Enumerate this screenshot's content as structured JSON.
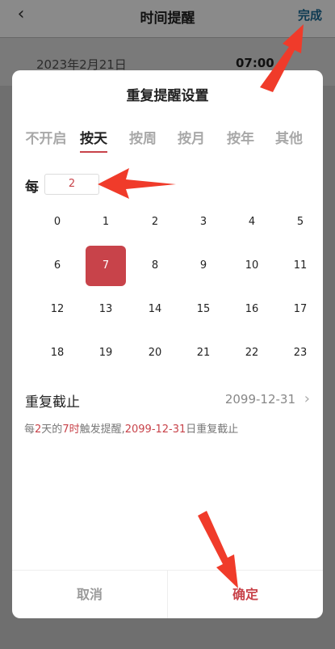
{
  "header": {
    "back_icon": "chevron-left-icon",
    "title": "时间提醒",
    "done_label": "完成"
  },
  "background_row": {
    "date": "2023年2月21日",
    "time": "07:00"
  },
  "dialog": {
    "title": "重复提醒设置",
    "tabs": [
      {
        "label": "不开启",
        "active": false
      },
      {
        "label": "按天",
        "active": true
      },
      {
        "label": "按周",
        "active": false
      },
      {
        "label": "按月",
        "active": false
      },
      {
        "label": "按年",
        "active": false
      },
      {
        "label": "其他",
        "active": false
      }
    ],
    "every_label": "每",
    "every_value": "2",
    "hours": [
      "0",
      "1",
      "2",
      "3",
      "4",
      "5",
      "6",
      "7",
      "8",
      "9",
      "10",
      "11",
      "12",
      "13",
      "14",
      "15",
      "16",
      "17",
      "18",
      "19",
      "20",
      "21",
      "22",
      "23"
    ],
    "selected_hour": "7",
    "repeat_end_label": "重复截止",
    "repeat_end_value": "2099-12-31",
    "summary": {
      "p1": "每",
      "n": "2",
      "p2": "天的",
      "h": "7时",
      "p3": "触发提醒,",
      "date": "2099-12-31",
      "p4": "日重复截止"
    },
    "cancel_label": "取消",
    "confirm_label": "确定"
  },
  "colors": {
    "accent": "#c8434a",
    "annotation_arrow": "#f03b2a"
  }
}
